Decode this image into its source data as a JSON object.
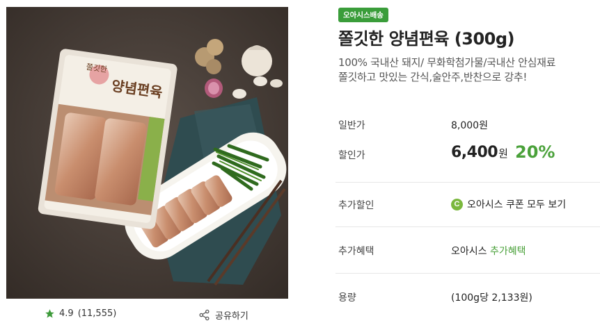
{
  "product": {
    "badge": "오아시스배송",
    "title": "쫄깃한 양념편육 (300g)",
    "desc_line1": "100% 국내산 돼지/ 무화학첨가물/국내산 안심재료",
    "desc_line2": "쫄깃하고 맛있는 간식,술안주,반찬으로 강추!",
    "package_label": "쫄깃한 양념편육"
  },
  "rating": {
    "score": "4.9",
    "count": "(11,555)",
    "icon": "star-icon"
  },
  "share": {
    "label": "공유하기",
    "icon": "share-icon"
  },
  "prices": {
    "regular_label": "일반가",
    "regular_value": "8,000원",
    "sale_label": "할인가",
    "sale_value": "6,400",
    "sale_unit": "원",
    "discount": "20%"
  },
  "extra_discount": {
    "label": "추가할인",
    "coupon_icon_letter": "C",
    "coupon_text": "오아시스 쿠폰 모두 보기"
  },
  "extra_benefit": {
    "label": "추가혜택",
    "prefix": "오아시스",
    "link": "추가혜택"
  },
  "volume": {
    "label": "용량",
    "value": "(100g당 2,133원)"
  },
  "colors": {
    "accent": "#4aa13a",
    "badge": "#3a9d3a",
    "coupon": "#7bb83e"
  }
}
